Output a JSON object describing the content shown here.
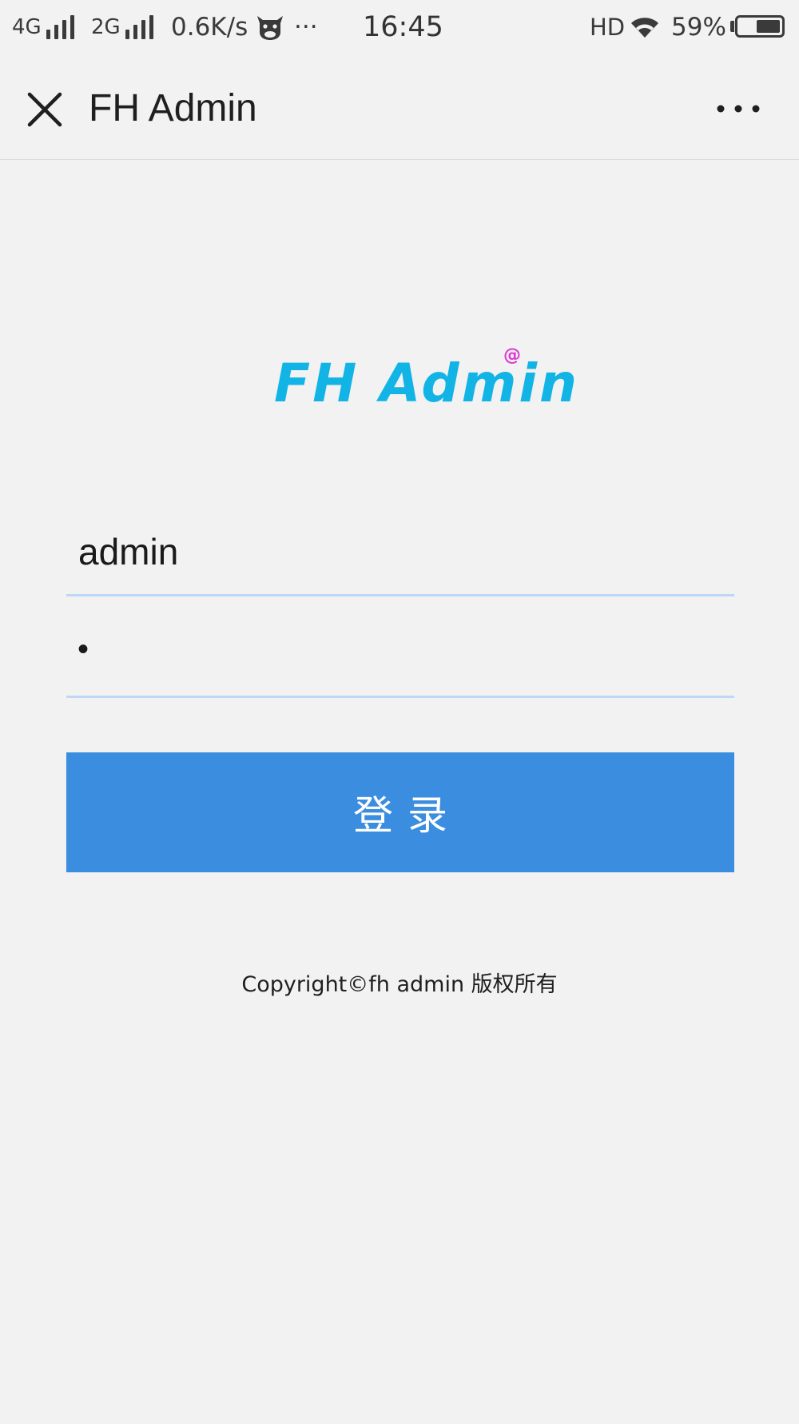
{
  "status_bar": {
    "net1": "4G",
    "net2": "2G",
    "speed": "0.6K/s",
    "app_icon": "cow-face-icon",
    "overflow": "···",
    "time": "16:45",
    "hd": "HD",
    "wifi_icon": "wifi-icon",
    "battery_text": "59%",
    "battery_level": 0.59
  },
  "nav": {
    "close_icon": "close-icon",
    "title": "FH Admin",
    "more_icon": "more-dots-icon"
  },
  "logo": {
    "text": "FH Admin",
    "mark": "@",
    "color": "#12b4e6",
    "mark_color": "#e038d2"
  },
  "form": {
    "username": "admin",
    "password_masked": "•",
    "submit_label": "登录",
    "accent": "#3b8de0",
    "underline_color": "#bcd8f4"
  },
  "footer": {
    "copyright": "Copyright©fh admin 版权所有"
  }
}
